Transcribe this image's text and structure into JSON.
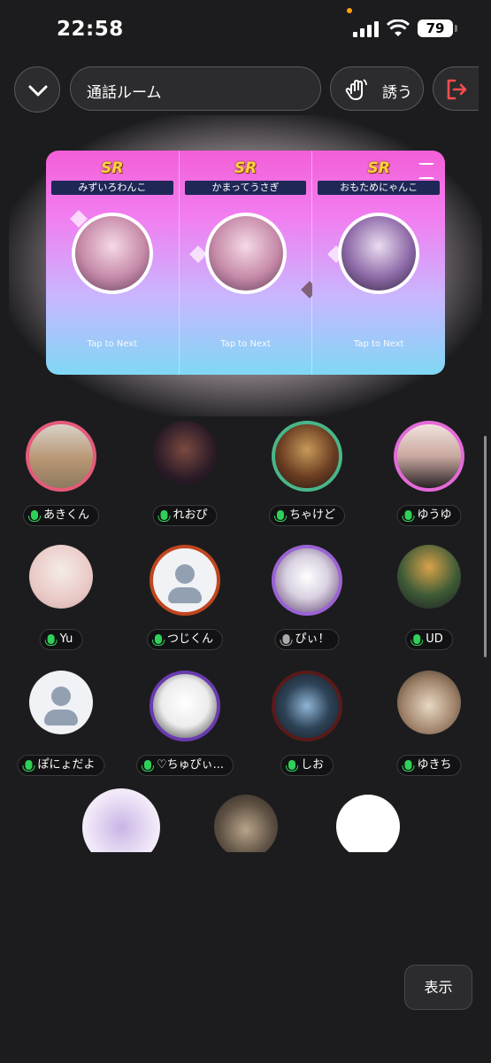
{
  "status_bar": {
    "time": "22:58",
    "battery": "79"
  },
  "header": {
    "room_title": "通話ルーム",
    "invite_label": "誘う"
  },
  "gacha": {
    "cards": [
      {
        "rarity": "SR",
        "name": "みずいろわんこ",
        "tap_label": "Tap to Next"
      },
      {
        "rarity": "SR",
        "name": "かまってうさぎ",
        "tap_label": "Tap to Next"
      },
      {
        "rarity": "SR",
        "name": "おもためにゃんこ",
        "tap_label": "Tap to Next"
      }
    ]
  },
  "members": [
    {
      "name": "あきくん",
      "mic": "on"
    },
    {
      "name": "れおぴ",
      "mic": "on"
    },
    {
      "name": "ちゃけど",
      "mic": "on"
    },
    {
      "name": "ゆうゆ",
      "mic": "on"
    },
    {
      "name": "Yu",
      "mic": "on"
    },
    {
      "name": "つじくん",
      "mic": "on"
    },
    {
      "name": "ぴぃ！",
      "mic": "muted"
    },
    {
      "name": "UD",
      "mic": "on"
    },
    {
      "name": "ぽにょだよ",
      "mic": "on"
    },
    {
      "name": "♡ちゅぴぃ...",
      "mic": "on"
    },
    {
      "name": "しお",
      "mic": "on"
    },
    {
      "name": "ゆきち",
      "mic": "on"
    }
  ],
  "footer": {
    "show_label": "表示"
  },
  "colors": {
    "background": "#1c1c1e",
    "mic_on": "#2fd158",
    "leave_icon": "#ff4d4d"
  }
}
